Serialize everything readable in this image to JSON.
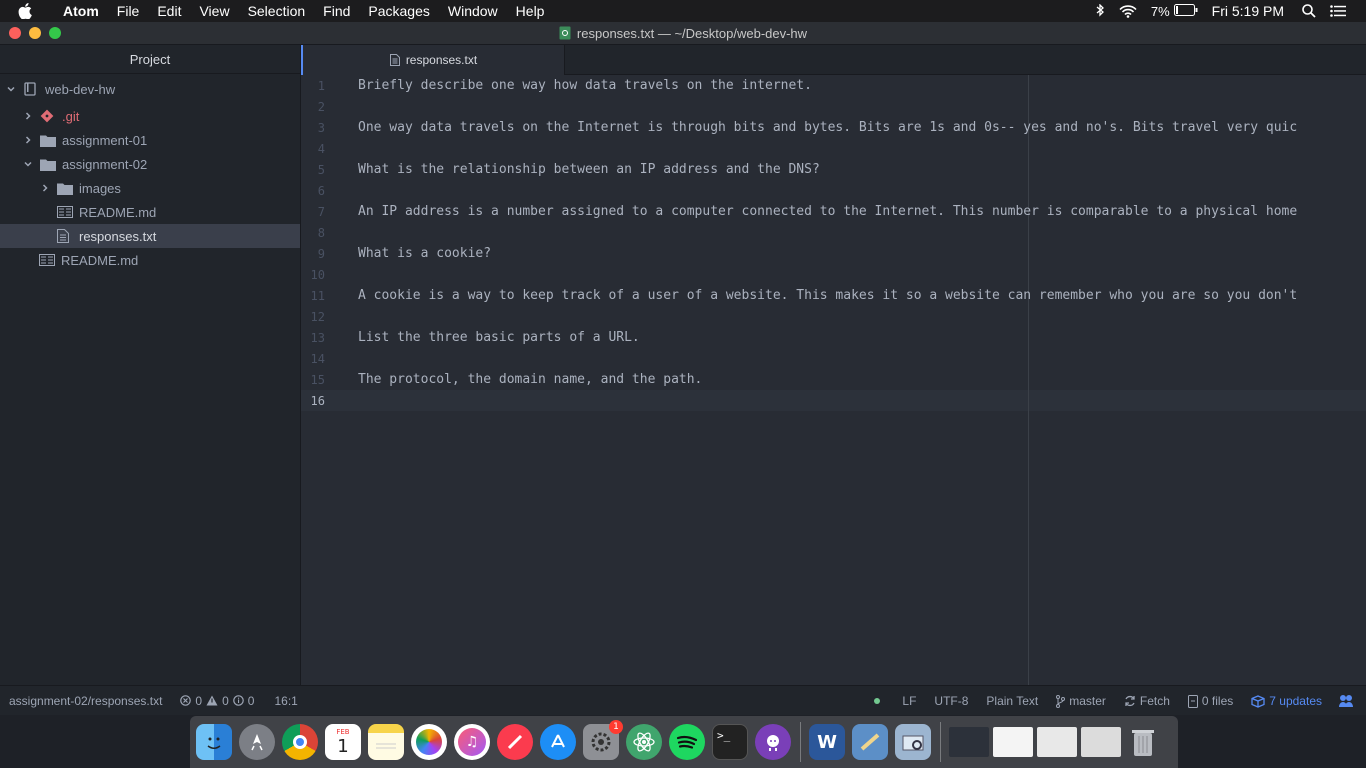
{
  "menubar": {
    "app_name": "Atom",
    "items": [
      "File",
      "Edit",
      "View",
      "Selection",
      "Find",
      "Packages",
      "Window",
      "Help"
    ],
    "battery": "7%",
    "clock": "Fri 5:19 PM"
  },
  "window": {
    "title": "responses.txt — ~/Desktop/web-dev-hw"
  },
  "tree": {
    "header": "Project",
    "rows": [
      {
        "label": "web-dev-hw",
        "type": "project"
      },
      {
        "label": ".git",
        "type": "git"
      },
      {
        "label": "assignment-01",
        "type": "folder"
      },
      {
        "label": "assignment-02",
        "type": "folder"
      },
      {
        "label": "images",
        "type": "folder"
      },
      {
        "label": "README.md",
        "type": "file-md"
      },
      {
        "label": "responses.txt",
        "type": "file-txt"
      },
      {
        "label": "README.md",
        "type": "file-md"
      }
    ]
  },
  "tab": {
    "label": "responses.txt"
  },
  "editor": {
    "line_numbers": [
      "1",
      "2",
      "3",
      "4",
      "5",
      "6",
      "7",
      "8",
      "9",
      "10",
      "11",
      "12",
      "13",
      "14",
      "15",
      "16"
    ],
    "lines": [
      "Briefly describe one way how data travels on the internet.",
      "",
      "One way data travels on the Internet is through bits and bytes. Bits are 1s and 0s-- yes and no's. Bits travel very quic",
      "",
      "What is the relationship between an IP address and the DNS?",
      "",
      "An IP address is a number assigned to a computer connected to the Internet. This number is comparable to a physical home",
      "",
      "What is a cookie?",
      "",
      "A cookie is a way to keep track of a user of a website. This makes it so a website can remember who you are so you don't",
      "",
      "List the three basic parts of a URL.",
      "",
      "The protocol, the domain name, and the path.",
      ""
    ],
    "current_line": 16
  },
  "status": {
    "path": "assignment-02/responses.txt",
    "errors": "0",
    "warnings": "0",
    "infos": "0",
    "cursor": "16:1",
    "line_ending": "LF",
    "encoding": "UTF-8",
    "grammar": "Plain Text",
    "branch": "master",
    "fetch": "Fetch",
    "files": "0 files",
    "updates": "7 updates"
  },
  "dock": {
    "calendar_month": "FEB",
    "calendar_day": "1",
    "sysprefs_badge": "1"
  },
  "colors": {
    "accent": "#568af2",
    "editor_bg": "#282c34",
    "panel_bg": "#21252b",
    "text": "#abb2bf",
    "git_red": "#e06c75"
  }
}
